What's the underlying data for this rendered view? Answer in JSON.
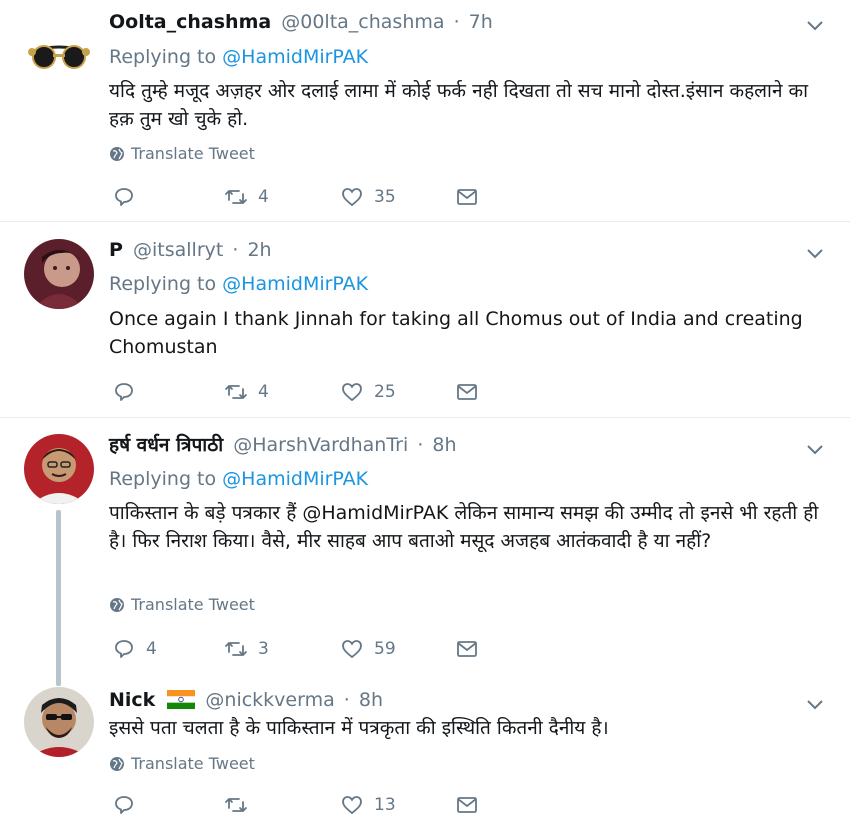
{
  "tweets": [
    {
      "name": "Oolta_chashma",
      "handle": "@00lta_chashma",
      "time": "7h",
      "replying_prefix": "Replying to",
      "replying_to": "@HamidMirPAK",
      "text": "यदि तुम्हे मजूद अज़हर ओर दलाई लामा में कोई फर्क नही दिखता तो सच मानो दोस्त.इंसान कहलाने का हक़ तुम खो चुके हो.",
      "translate_label": "Translate Tweet",
      "reply_count": "",
      "retweet_count": "4",
      "like_count": "35"
    },
    {
      "name": "P",
      "handle": "@itsallryt",
      "time": "2h",
      "replying_prefix": "Replying to",
      "replying_to": "@HamidMirPAK",
      "text": "Once again I thank Jinnah for taking all Chomus out of India and creating Chomustan",
      "reply_count": "",
      "retweet_count": "4",
      "like_count": "25"
    },
    {
      "name": "हर्ष वर्धन त्रिपाठी",
      "handle": "@HarshVardhanTri",
      "time": "8h",
      "replying_prefix": "Replying to",
      "replying_to": "@HamidMirPAK",
      "text": "पाकिस्तान के बड़े पत्रकार हैं @HamidMirPAK लेकिन सामान्य समझ की उम्मीद तो इनसे भी रहती ही है। फिर निराश किया। वैसे, मीर साहब आप बताओ मसूद अजहब आतंकवादी है या नहीं?",
      "translate_label": "Translate Tweet",
      "reply_count": "4",
      "retweet_count": "3",
      "like_count": "59"
    },
    {
      "name": "Nick",
      "handle": "@nickkverma",
      "time": "8h",
      "text": "इससे पता चलता है के पाकिस्तान में पत्रकृता की इस्थिति कितनी दैनीय है।",
      "translate_label": "Translate Tweet",
      "reply_count": "",
      "retweet_count": "",
      "like_count": "13"
    }
  ],
  "icons": {
    "reply": "reply-icon",
    "retweet": "retweet-icon",
    "like": "heart-icon",
    "dm": "envelope-icon",
    "caret": "chevron-down-icon",
    "translate": "globe-icon",
    "flag": "india-flag-icon"
  },
  "colors": {
    "text_primary": "#14171a",
    "text_secondary": "#657786",
    "mention_blue": "#1b95e0",
    "divider": "#e6ecf0",
    "thread_line": "#b9c3cc"
  }
}
